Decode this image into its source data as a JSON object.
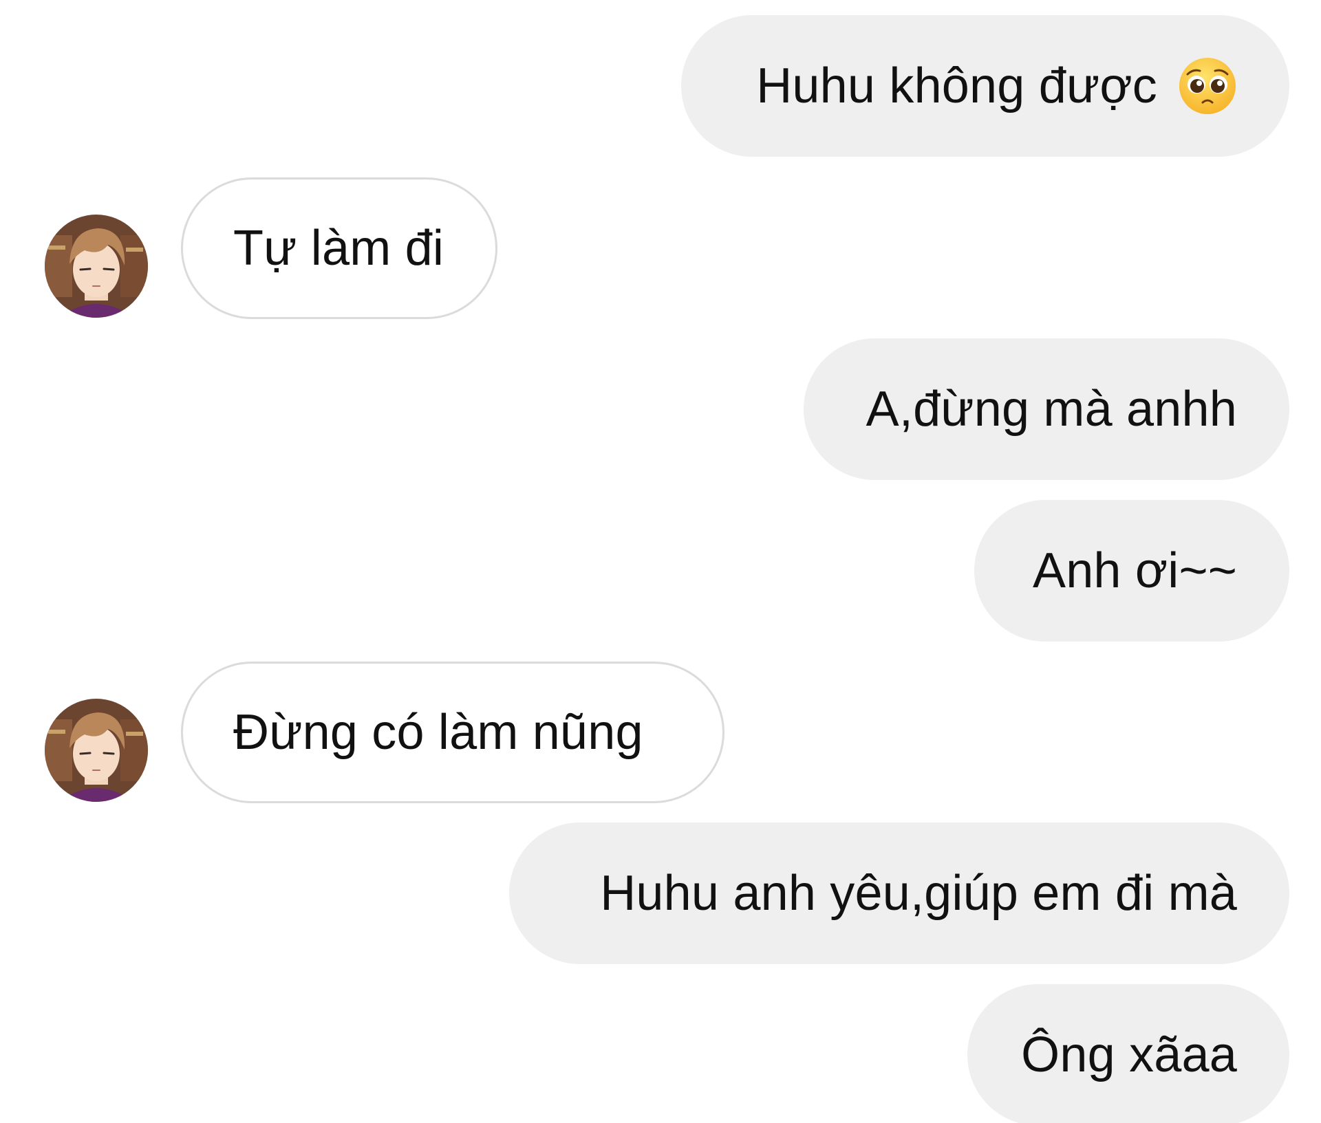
{
  "conversation": {
    "messages": [
      {
        "sender": "me",
        "text": "Huhu không được",
        "emoji": "pleading-face-icon"
      },
      {
        "sender": "contact",
        "text": "Tự làm đi"
      },
      {
        "sender": "me",
        "text": "A,đừng mà anhh"
      },
      {
        "sender": "me",
        "text": "Anh ơi~~"
      },
      {
        "sender": "contact",
        "text": "Đừng có làm nũng"
      },
      {
        "sender": "me",
        "text": "Huhu anh yêu,giúp em đi mà"
      },
      {
        "sender": "me",
        "text": "Ông xãaa"
      }
    ]
  },
  "colors": {
    "sent_bubble": "#efefef",
    "received_bubble_border": "#dbdbdb",
    "text": "#111111"
  }
}
